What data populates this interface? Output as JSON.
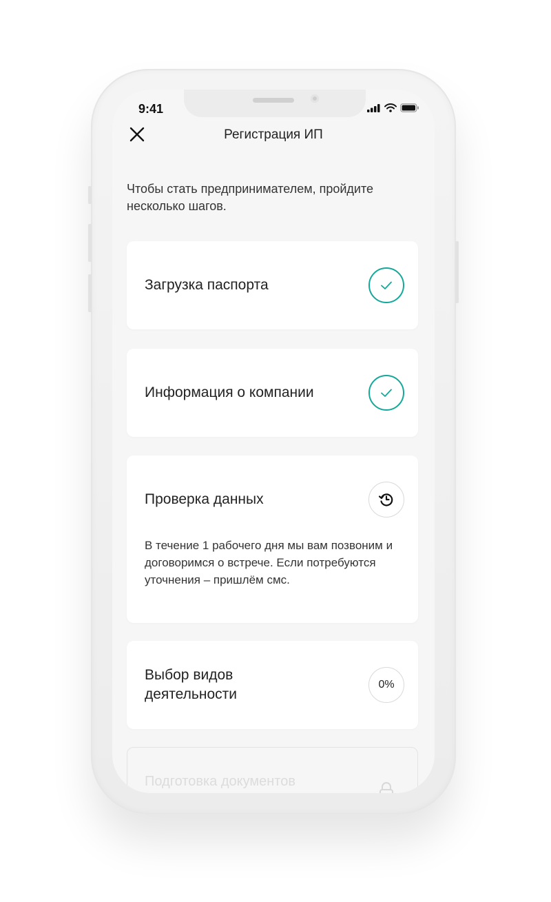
{
  "status_bar": {
    "time": "9:41"
  },
  "nav": {
    "title": "Регистрация ИП",
    "close_icon": "close-icon"
  },
  "intro": "Чтобы стать предпринимателем, пройдите несколько шагов.",
  "steps": [
    {
      "title": "Загрузка паспорта",
      "status": "done",
      "icon": "check-icon"
    },
    {
      "title": "Информация о компании",
      "status": "done",
      "icon": "check-icon"
    },
    {
      "title": "Проверка данных",
      "status": "in-progress",
      "icon": "history-icon",
      "description": "В течение 1 рабочего дня мы вам позвоним и договоримся о встрече. Если потребуются уточнения – пришлём смс."
    },
    {
      "title": "Выбор видов деятельности",
      "status": "progress",
      "progress": "0%",
      "progress_value": 0
    },
    {
      "title": "Подготовка документов",
      "status": "locked",
      "icon": "lock-icon"
    }
  ],
  "colors": {
    "accent": "#14a89a",
    "background": "#f6f6f6",
    "card": "#ffffff",
    "text": "#222222",
    "disabled_text": "#dcdcdc"
  }
}
